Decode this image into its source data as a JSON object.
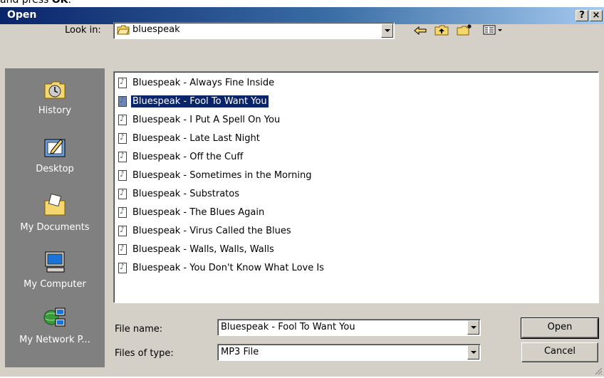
{
  "instruction": {
    "prefix": "and press ",
    "bold": "OK",
    "suffix": "."
  },
  "titlebar": {
    "title": "Open",
    "help": "?",
    "close": "×"
  },
  "look_in": {
    "label": "Look in:",
    "value": "bluespeak"
  },
  "sidebar": {
    "items": [
      {
        "label": "History",
        "icon": "history-icon"
      },
      {
        "label": "Desktop",
        "icon": "desktop-icon"
      },
      {
        "label": "My Documents",
        "icon": "my-documents-icon"
      },
      {
        "label": "My Computer",
        "icon": "my-computer-icon"
      },
      {
        "label": "My Network P...",
        "icon": "my-network-places-icon"
      }
    ]
  },
  "files": [
    "Bluespeak - Always Fine Inside",
    "Bluespeak - Fool To Want You",
    "Bluespeak - I Put A Spell On You",
    "Bluespeak - Late Last Night",
    "Bluespeak - Off the Cuff",
    "Bluespeak - Sometimes in the Morning",
    "Bluespeak - Substratos",
    "Bluespeak - The Blues Again",
    "Bluespeak - Virus Called the Blues",
    "Bluespeak - Walls, Walls, Walls",
    "Bluespeak - You Don't Know What Love Is"
  ],
  "selected_file_index": 1,
  "file_name": {
    "label": "File name:",
    "value": "Bluespeak - Fool To Want You"
  },
  "file_type": {
    "label": "Files of type:",
    "value": "MP3 File"
  },
  "buttons": {
    "open": "Open",
    "cancel": "Cancel"
  },
  "colors": {
    "titlebar_start": "#0a246a",
    "selection": "#0a246a",
    "sidebar_bg": "#808080",
    "dialog_bg": "#d4d0c8"
  }
}
